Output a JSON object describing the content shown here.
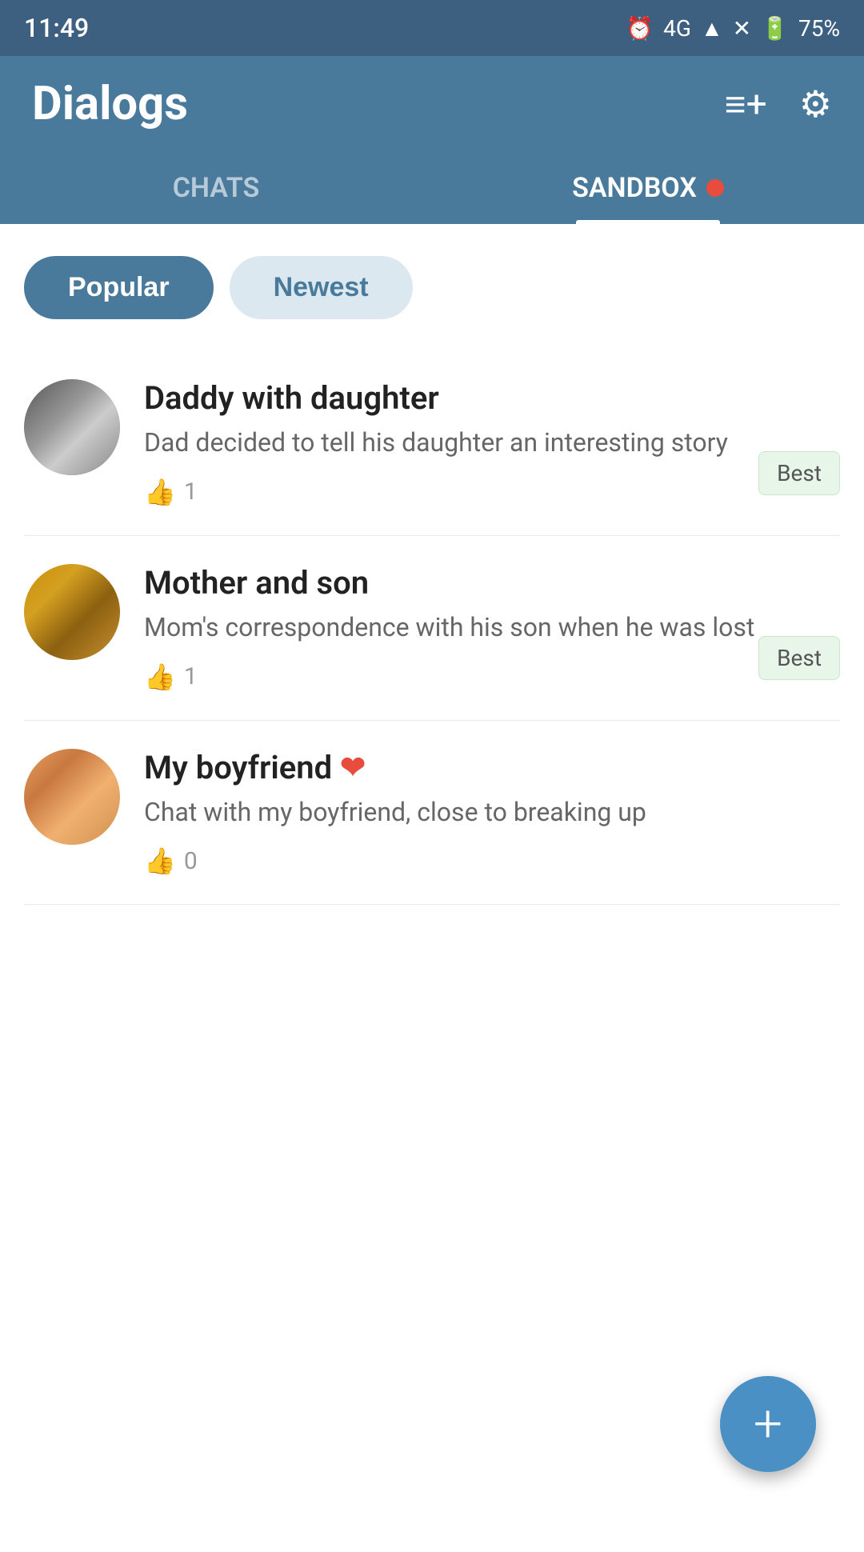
{
  "statusBar": {
    "time": "11:49",
    "battery": "75%",
    "network": "4G"
  },
  "header": {
    "title": "Dialogs",
    "addIcon": "≡+",
    "settingsIcon": "⚙"
  },
  "tabs": [
    {
      "id": "chats",
      "label": "CHATS",
      "active": false
    },
    {
      "id": "sandbox",
      "label": "SANDBOX",
      "active": true,
      "badge": true
    }
  ],
  "filters": [
    {
      "id": "popular",
      "label": "Popular",
      "active": true
    },
    {
      "id": "newest",
      "label": "Newest",
      "active": false
    }
  ],
  "chatItems": [
    {
      "id": "daddy-daughter",
      "title": "Daddy with daughter",
      "description": "Dad decided to tell his daughter an interesting story",
      "likes": 1,
      "badge": "Best",
      "hasHeart": false,
      "avatarClass": "avatar-daddy"
    },
    {
      "id": "mother-son",
      "title": "Mother and son",
      "description": "Mom's correspondence with his son when he was lost",
      "likes": 1,
      "badge": "Best",
      "hasHeart": false,
      "avatarClass": "avatar-mother"
    },
    {
      "id": "my-boyfriend",
      "title": "My boyfriend",
      "description": "Chat with my boyfriend, close to breaking up",
      "likes": 0,
      "badge": null,
      "hasHeart": true,
      "avatarClass": "avatar-boyfriend"
    }
  ],
  "fab": {
    "label": "+"
  }
}
